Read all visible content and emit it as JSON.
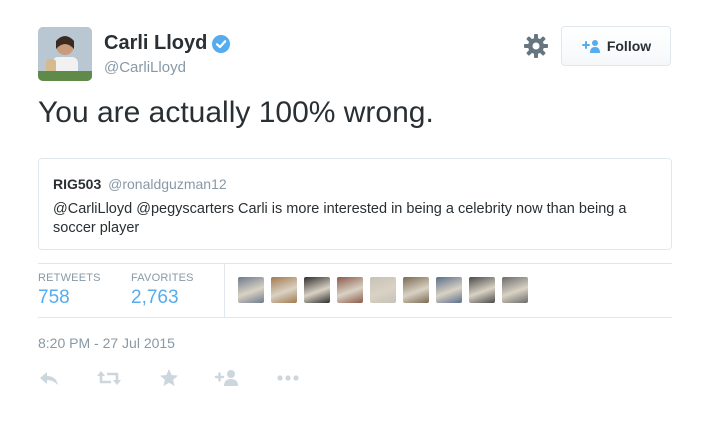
{
  "author": {
    "name": "Carli Lloyd",
    "handle": "@CarliLloyd",
    "verified": true,
    "avatar_icon": "user-avatar"
  },
  "follow_button": {
    "label": "Follow",
    "icon": "add-user-icon"
  },
  "settings_icon": "gear-icon",
  "tweet": {
    "text": "You are actually 100% wrong."
  },
  "quoted_tweet": {
    "name": "RIG503",
    "handle": "@ronaldguzman12",
    "text": "@CarliLloyd @pegyscarters Carli is more interested in being a celebrity now than being a soccer player"
  },
  "stats": {
    "retweets_label": "RETWEETS",
    "retweets_value": "758",
    "favorites_label": "FAVORITES",
    "favorites_value": "2,763"
  },
  "favoriter_faces": [
    {
      "icon": "favoriter-avatar",
      "color": "#6d7a8c"
    },
    {
      "icon": "favoriter-avatar",
      "color": "#a27a4e"
    },
    {
      "icon": "favoriter-avatar",
      "color": "#2f2f2f"
    },
    {
      "icon": "favoriter-avatar",
      "color": "#8a5a4a"
    },
    {
      "icon": "favoriter-avatar",
      "color": "#c7c2b8"
    },
    {
      "icon": "favoriter-avatar",
      "color": "#7a6a52"
    },
    {
      "icon": "favoriter-avatar",
      "color": "#5a6e8a"
    },
    {
      "icon": "favoriter-avatar",
      "color": "#4a4a4a"
    },
    {
      "icon": "favoriter-avatar",
      "color": "#6b6b6b"
    }
  ],
  "timestamp": "8:20 PM - 27 Jul 2015",
  "actions": [
    "reply-icon",
    "retweet-icon",
    "favorite-icon",
    "follow-icon",
    "more-icon"
  ],
  "colors": {
    "text": "#292f33",
    "muted": "#8899a6",
    "link": "#55acee",
    "border": "#e1e8ed",
    "verified": "#55acee",
    "action_icon": "#ccd6dd"
  }
}
